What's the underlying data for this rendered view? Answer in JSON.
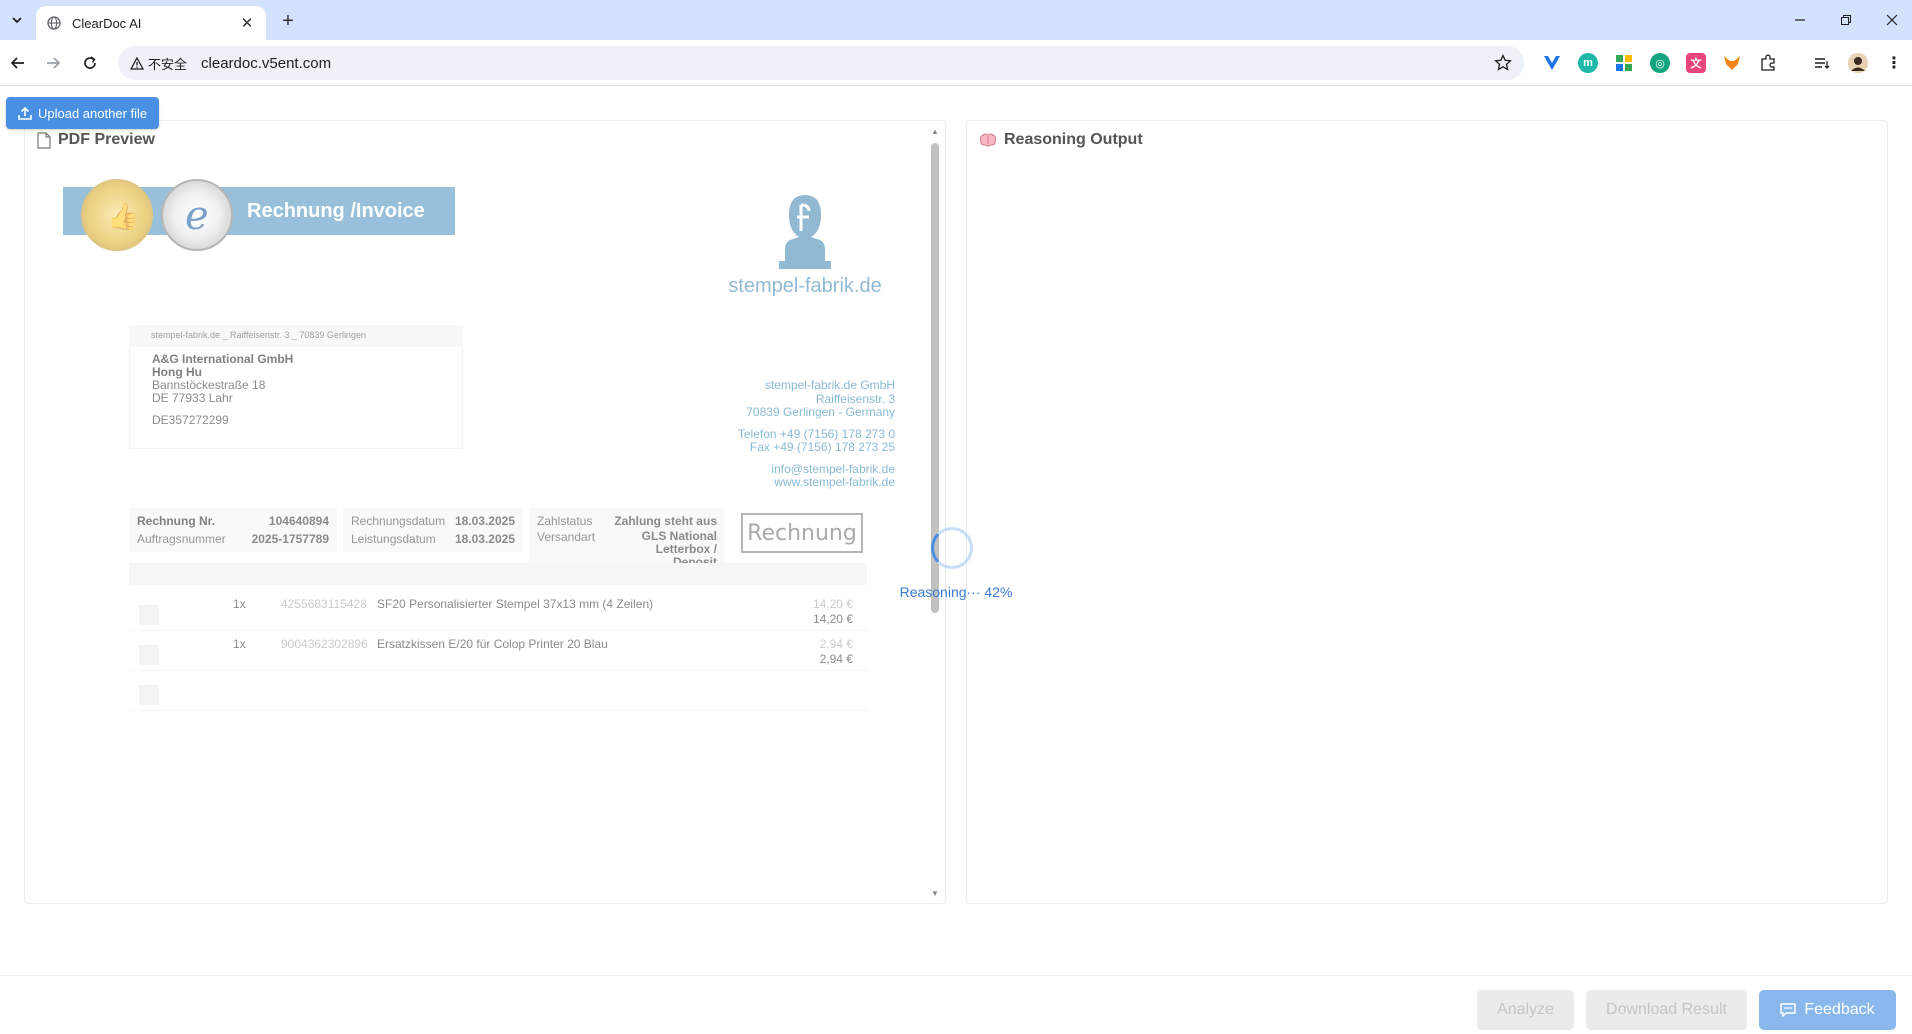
{
  "browser": {
    "tab_title": "ClearDoc AI",
    "security_label": "不安全",
    "url": "cleardoc.v5ent.com"
  },
  "app": {
    "upload_label": "Upload another file",
    "pdf_panel_title": "PDF Preview",
    "reasoning_panel_title": "Reasoning Output",
    "reasoning_status": "Reasoning··· 42%",
    "progress_percent": 42
  },
  "document": {
    "banner_title": "Rechnung /Invoice",
    "brand": "stempel-fabrik.de",
    "sender_line": "stempel-fabrik.de _ Raiffeisenstr. 3 _ 70839 Gerlingen",
    "recipient": {
      "company": "A&G International GmbH",
      "name": "Hong Hu",
      "street": "Bannstöckestraße 18",
      "city": "DE 77933 Lahr",
      "vat": "DE357272299"
    },
    "company": {
      "name": "stempel-fabrik.de GmbH",
      "street": "Raiffeisenstr. 3",
      "city": "70839 Gerlingen - Germany",
      "phone": "Telefon +49 (7156) 178 273 0",
      "fax": "Fax +49 (7156) 178 273 25",
      "email": "info@stempel-fabrik.de",
      "web": "www.stempel-fabrik.de"
    },
    "meta": {
      "invoice_no_label": "Rechnung Nr.",
      "invoice_no": "104640894",
      "order_no_label": "Auftragsnummer",
      "order_no": "2025-1757789",
      "invoice_date_label": "Rechnungsdatum",
      "invoice_date": "18.03.2025",
      "service_date_label": "Leistungsdatum",
      "service_date": "18.03.2025",
      "pay_status_label": "Zahlstatus",
      "pay_status": "Zahlung steht aus",
      "shipping_label": "Versandart",
      "shipping": "GLS National Letterbox / Deposit"
    },
    "stamp_text": "Rechnung",
    "items": [
      {
        "qty": "1x",
        "ean": "4255683115428",
        "desc": "SF20 Personalisierter Stempel 37x13 mm (4 Zeilen)",
        "unit_price": "14,20 €",
        "total": "14,20 €"
      },
      {
        "qty": "1x",
        "ean": "9004362302896",
        "desc": "Ersatzkissen E/20 für Colop Printer 20 Blau",
        "unit_price": "2,94 €",
        "total": "2,94 €"
      }
    ]
  },
  "footer": {
    "analyze": "Analyze",
    "download": "Download Result",
    "feedback": "Feedback"
  }
}
